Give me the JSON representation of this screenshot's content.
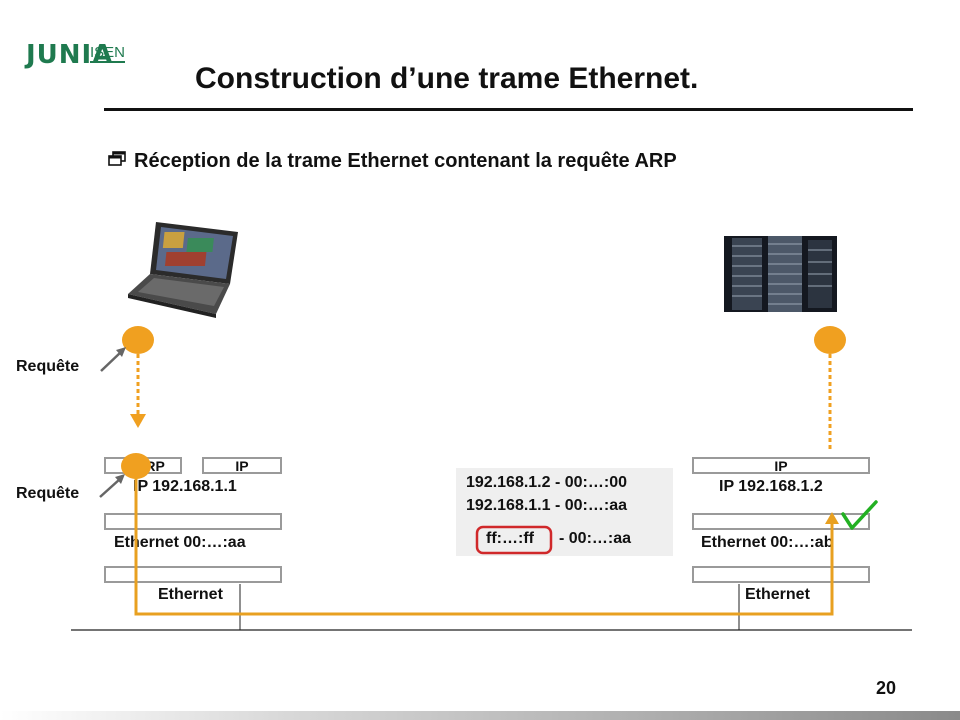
{
  "header": {
    "logo_main": "JUNIA",
    "logo_sub": "ISEN"
  },
  "slide": {
    "title": "Construction d’une trame Ethernet.",
    "bullet": "Réception de la trame Ethernet contenant la requête ARP",
    "page_number": "20"
  },
  "left_host": {
    "arrow_label_top": "Requête",
    "arrow_label_bottom": "Requête",
    "box_arp": "ARP",
    "box_ip": "IP",
    "ip_label": "IP 192.168.1.1",
    "eth_label": "Ethernet 00:…:aa",
    "link_label": "Ethernet"
  },
  "right_host": {
    "box_ip": "IP",
    "ip_label": "IP 192.168.1.2",
    "eth_label": "Ethernet 00:…:ab",
    "link_label": "Ethernet"
  },
  "arp_table": {
    "row1": "192.168.1.2 - 00:…:00",
    "row2": "192.168.1.1 - 00:…:aa",
    "frame_dst": "ff:…:ff",
    "frame_src": "- 00:…:aa"
  },
  "colors": {
    "accent_orange": "#f0a020",
    "frame_path": "#e8a020",
    "highlight_red": "#d0282a",
    "check_green": "#22b022",
    "logo_green": "#1f7a4f"
  },
  "icons": [
    "laptop-image",
    "server-rack-image",
    "window-bullet-icon",
    "check-icon"
  ]
}
